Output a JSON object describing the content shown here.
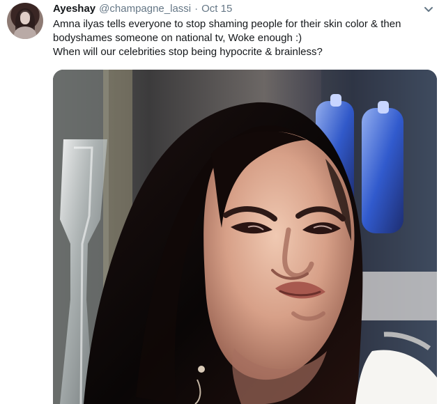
{
  "tweet": {
    "author_name": "Ayeshay",
    "handle": "@champagne_lassi",
    "separator": "·",
    "date": "Oct 15",
    "text_lines": [
      "Amna ilyas tells everyone to stop shaming people for their skin color & then",
      "bodyshames someone on national tv, Woke enough :)",
      "When will our celebrities stop being hypocrite & brainless?"
    ]
  },
  "icons": {
    "menu": "chevron-down-icon",
    "avatar": "profile-avatar"
  },
  "colors": {
    "primary_text": "#14171a",
    "secondary_text": "#657786",
    "chevron": "#657786"
  }
}
